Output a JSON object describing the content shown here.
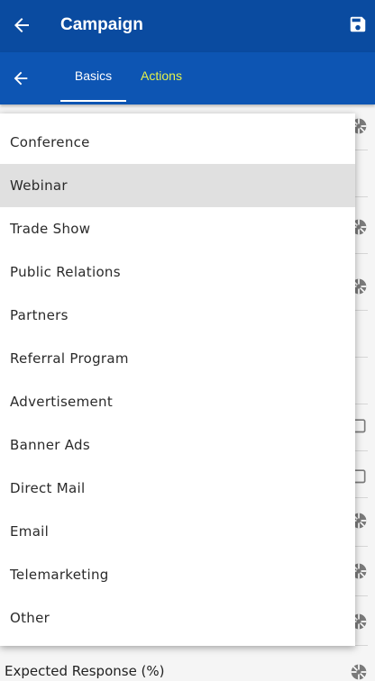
{
  "header": {
    "title": "Campaign"
  },
  "tabs": [
    {
      "label": "Basics",
      "active": true
    },
    {
      "label": "Actions",
      "active": false
    }
  ],
  "dropdown": {
    "selected": "Webinar",
    "options": [
      "Conference",
      "Webinar",
      "Trade Show",
      "Public Relations",
      "Partners",
      "Referral Program",
      "Advertisement",
      "Banner Ads",
      "Direct Mail",
      "Email",
      "Telemarketing",
      "Other"
    ]
  },
  "background": {
    "field_label": "Expected Response (%)"
  },
  "colors": {
    "appbar": "#0a4ba0",
    "tabbar": "#0d55b3",
    "actions_tab": "#e5f24a"
  }
}
